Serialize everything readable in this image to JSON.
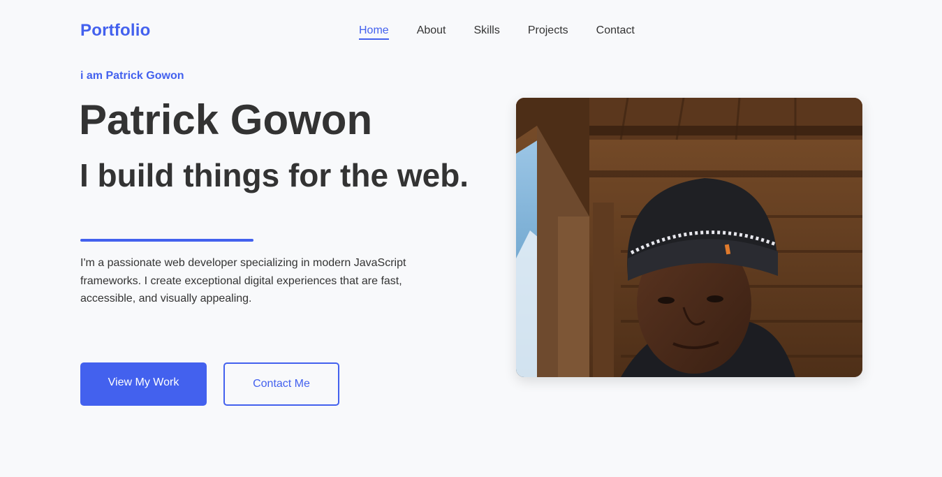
{
  "header": {
    "logo": "Portfolio",
    "nav": [
      {
        "label": "Home",
        "active": true
      },
      {
        "label": "About",
        "active": false
      },
      {
        "label": "Skills",
        "active": false
      },
      {
        "label": "Projects",
        "active": false
      },
      {
        "label": "Contact",
        "active": false
      }
    ]
  },
  "hero": {
    "intro": "i am Patrick Gowon",
    "name": "Patrick Gowon",
    "tagline": "I build things for the web.",
    "description": "I'm a passionate web developer specializing in modern JavaScript frameworks. I create exceptional digital experiences that are fast, accessible, and visually appealing.",
    "primary_button": "View My Work",
    "secondary_button": "Contact Me"
  },
  "colors": {
    "accent": "#4361ee",
    "text": "#333333",
    "background": "#f8f9fb"
  },
  "icons": {
    "profile_photo": "profile-photo"
  }
}
